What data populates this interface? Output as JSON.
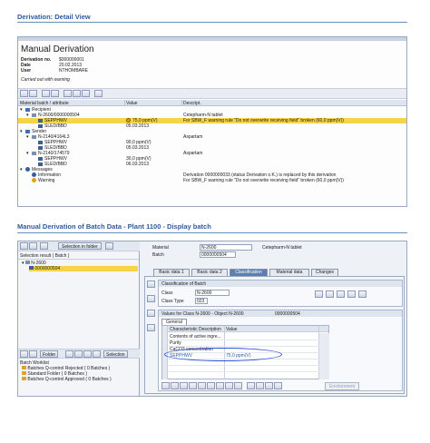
{
  "top": {
    "title": "Derivation: Detail View",
    "heading": "Manual Derivation",
    "info": [
      {
        "label": "Derivation no.",
        "value": "$000000001"
      },
      {
        "label": "Date",
        "value": "20.02.2013"
      },
      {
        "label": "User",
        "value": "NTHOMBARE"
      }
    ],
    "note": "Carried out with warning",
    "columns": [
      "Material batch / attribute",
      "Value",
      "Descript."
    ],
    "rows": [
      {
        "label": "Recipient",
        "value": "",
        "desc": ""
      },
      {
        "label": "N-2600/0000000504",
        "value": "",
        "desc": "Cetepharm-N tablet"
      },
      {
        "label": "SEPPHWV",
        "value": "75,0 ppm(V)",
        "desc": "For SBW_F warning rule \"Do not overwrite receiving field\" broken (60,0 ppm(V))"
      },
      {
        "label": "SLED/BBD",
        "value": "05.03.2013",
        "desc": ""
      },
      {
        "label": "Sender",
        "value": "",
        "desc": ""
      },
      {
        "label": "N-2140/4164L3",
        "value": "",
        "desc": "Aspartam"
      },
      {
        "label": "SEPPHWV",
        "value": "90,0 ppm(V)",
        "desc": ""
      },
      {
        "label": "SLED/BBD",
        "value": "05.03.2013",
        "desc": ""
      },
      {
        "label": "N-2140/174579",
        "value": "",
        "desc": "Aspartam"
      },
      {
        "label": "SEPPHWV",
        "value": "30,0 ppm(V)",
        "desc": ""
      },
      {
        "label": "SLED/BBD",
        "value": "06.03.2013",
        "desc": ""
      },
      {
        "label": "Messages",
        "value": "",
        "desc": ""
      },
      {
        "label": "Information",
        "value": "",
        "desc": "Derivation 0000000033 (status Derivation o.K.) is replaced by this derivation"
      },
      {
        "label": "Warning",
        "value": "",
        "desc": "For SBW_F warning rule \"Do not overwrite receiving field\" broken (60,0 ppm(V))"
      }
    ]
  },
  "bottom": {
    "title": "Manual Derivation of Batch Data  - Plant 1100 - Display batch",
    "selection_btn": "Selection in folder",
    "selection_result": "Selection result  ( Batch )",
    "tree": [
      "N-2600",
      "0000000504"
    ],
    "folder_btn": "Folder",
    "selection_btn2": "Selection",
    "worklist_title": "Batch Worklist",
    "worklist": [
      "Batches Q-control Rejected ( 0 Batches )",
      "Standard Folder ( 0 Batches )",
      "Batches Q-control Approved ( 0 Batches )"
    ],
    "material_label": "Material",
    "material_value": "N-2600",
    "material_desc": "Cetepharm-N tablet",
    "batch_label": "Batch",
    "batch_value": "0000000504",
    "tabs": [
      "Basic data 1",
      "Basic data 2",
      "Classification",
      "Material data",
      "Changes"
    ],
    "classification_title": "Classification of Batch",
    "class_label": "Class",
    "class_value": "N-2600",
    "class_type_label": "Class Type",
    "class_type_value": "023",
    "values_title": "Values for Class N-2600 - Object N-2600",
    "values_object": "0000000504",
    "general_tab": "General",
    "char_columns": [
      "Characteristic Description",
      "Value"
    ],
    "chars": [
      {
        "name": "Contents of active ingre...",
        "value": ""
      },
      {
        "name": "Purity",
        "value": ""
      },
      {
        "name": "CaCO3 concentration",
        "value": ""
      },
      {
        "name": "SEPPHWV",
        "value": "75,0 ppm(V)"
      }
    ],
    "environment_btn": "Environment",
    "highlight_color": "#f6d44a",
    "accent_color": "#2c5aa0"
  }
}
